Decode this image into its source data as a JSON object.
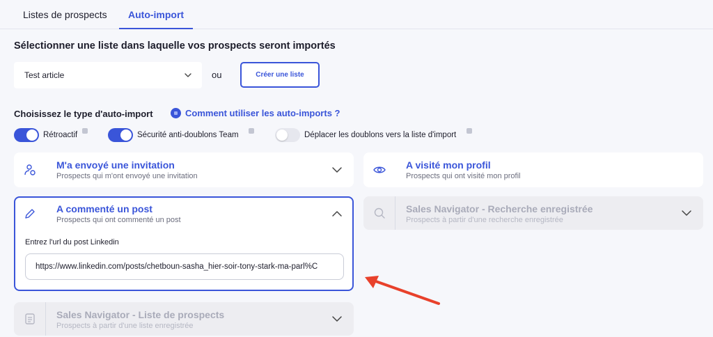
{
  "tabs": [
    {
      "label": "Listes de prospects"
    },
    {
      "label": "Auto-import"
    }
  ],
  "list_section": {
    "title": "Sélectionner une liste dans laquelle vos prospects seront importés",
    "selected_list": "Test article",
    "or_label": "ou",
    "create_button": "Créer une liste"
  },
  "import_type": {
    "title": "Choisissez le type d'auto-import",
    "help_link": "Comment utiliser les auto-imports ?"
  },
  "toggles": [
    {
      "label": "Rétroactif",
      "on": true
    },
    {
      "label": "Sécurité anti-doublons Team",
      "on": true
    },
    {
      "label": "Déplacer les doublons vers la liste d'import",
      "on": false
    }
  ],
  "cards": {
    "invitation": {
      "title": "M'a envoyé une invitation",
      "subtitle": "Prospects qui m'ont envoyé une invitation",
      "icon": "user-invite-icon"
    },
    "visited": {
      "title": "A visité mon profil",
      "subtitle": "Prospects qui ont visité mon profil",
      "icon": "eye-icon"
    },
    "commented": {
      "title": "A commenté un post",
      "subtitle": "Prospects qui ont commenté un post",
      "icon": "pencil-icon",
      "url_label": "Entrez l'url du post Linkedin",
      "url_value": "https://www.linkedin.com/posts/chetboun-sasha_hier-soir-tony-stark-ma-parl%C"
    },
    "sales_search": {
      "title": "Sales Navigator - Recherche enregistrée",
      "subtitle": "Prospects à partir d'une recherche enregistrée",
      "icon": "search-icon"
    },
    "sales_list": {
      "title": "Sales Navigator - Liste de prospects",
      "subtitle": "Prospects à partir d'une liste enregistrée",
      "icon": "document-icon"
    }
  },
  "colors": {
    "accent": "#3a55d9",
    "annotation_arrow": "#e8412b"
  }
}
